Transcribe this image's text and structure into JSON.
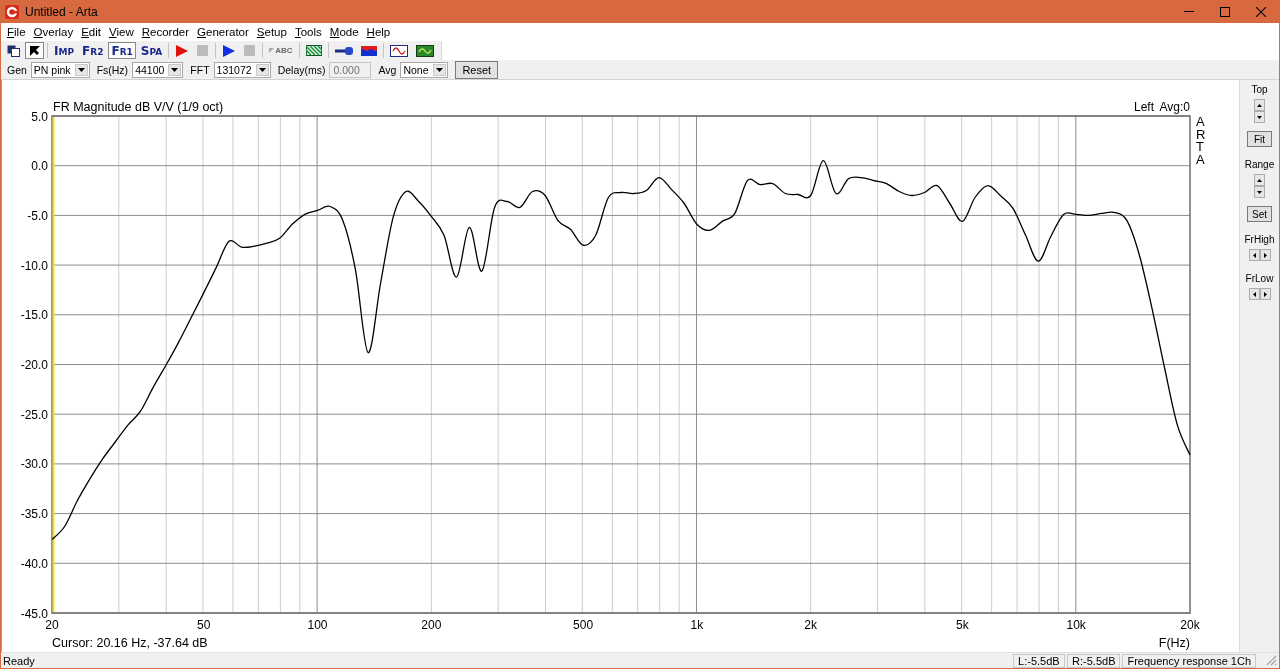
{
  "window": {
    "title": "Untitled - Arta"
  },
  "menu": [
    "File",
    "Overlay",
    "Edit",
    "View",
    "Recorder",
    "Generator",
    "Setup",
    "Tools",
    "Mode",
    "Help"
  ],
  "toolbar": [
    [
      {
        "kind": "pages",
        "selected": false,
        "disabled": false
      },
      {
        "kind": "pointer",
        "selected": true,
        "disabled": false
      }
    ],
    [
      {
        "kind": "text",
        "label": "IMP",
        "selected": false,
        "disabled": false
      },
      {
        "kind": "text",
        "label": "FR2",
        "selected": false,
        "disabled": false
      },
      {
        "kind": "text",
        "label": "FR1",
        "selected": true,
        "disabled": false
      },
      {
        "kind": "text",
        "label": "SPA",
        "selected": false,
        "disabled": false
      }
    ],
    [
      {
        "kind": "play",
        "color": "#e01010",
        "selected": false,
        "disabled": false
      },
      {
        "kind": "stop",
        "selected": false,
        "disabled": true
      }
    ],
    [
      {
        "kind": "play",
        "color": "#1030e0",
        "selected": false,
        "disabled": false
      },
      {
        "kind": "stop",
        "selected": false,
        "disabled": true
      }
    ],
    [
      {
        "kind": "abc",
        "label": "ABC",
        "selected": false,
        "disabled": true
      }
    ],
    [
      {
        "kind": "hatch",
        "selected": false,
        "disabled": false
      }
    ],
    [
      {
        "kind": "probe",
        "selected": false,
        "disabled": false
      },
      {
        "kind": "bars",
        "selected": false,
        "disabled": false
      }
    ],
    [
      {
        "kind": "wave",
        "selected": false,
        "disabled": false
      },
      {
        "kind": "scope",
        "selected": false,
        "disabled": false
      }
    ]
  ],
  "settings": [
    {
      "kind": "combo",
      "label": "Gen",
      "value": "PN pink",
      "disabled": false
    },
    {
      "kind": "combo",
      "label": "Fs(Hz)",
      "value": "44100",
      "disabled": false
    },
    {
      "kind": "combo",
      "label": "FFT",
      "value": "131072",
      "disabled": false
    },
    {
      "kind": "field",
      "label": "Delay(ms)",
      "value": "0.000",
      "disabled": true
    },
    {
      "kind": "combo",
      "label": "Avg",
      "value": "None",
      "disabled": false
    },
    {
      "kind": "button",
      "label": "Reset",
      "disabled": false
    }
  ],
  "plot": {
    "chart_data": {
      "type": "line",
      "title": "FR Magnitude dB V/V (1/9 oct)",
      "xlabel": "F(Hz)",
      "categories": [
        "20",
        null,
        null,
        null,
        null,
        null,
        null,
        null,
        null,
        null,
        null,
        null,
        "50",
        null,
        null,
        null,
        null,
        null,
        null,
        null,
        null,
        "100",
        null,
        null,
        null,
        null,
        null,
        null,
        null,
        null,
        "200",
        null,
        null,
        null,
        null,
        null,
        null,
        null,
        null,
        null,
        null,
        null,
        "500",
        null,
        null,
        null,
        null,
        null,
        null,
        null,
        null,
        "1k",
        null,
        null,
        null,
        null,
        null,
        null,
        null,
        null,
        "2k",
        null,
        null,
        null,
        null,
        null,
        null,
        null,
        null,
        null,
        null,
        null,
        "5k",
        null,
        null,
        null,
        null,
        null,
        null,
        null,
        null,
        "10k",
        null,
        null,
        null,
        null,
        null,
        null,
        null,
        null,
        "20k"
      ],
      "series": [
        {
          "name": "Left",
          "color": "#000000",
          "values": [
            -37.6,
            -36.3,
            -33.7,
            -31.5,
            -29.5,
            -27.8,
            -26.1,
            -24.7,
            -22.3,
            -20.1,
            -17.8,
            -15.3,
            -12.8,
            -10.2,
            -7.6,
            -8.2,
            -8.1,
            -7.8,
            -7.3,
            -5.9,
            -4.9,
            -4.5,
            -4.1,
            -5.5,
            -10.5,
            -18.8,
            -11.7,
            -5.1,
            -2.6,
            -3.6,
            -5.1,
            -7.0,
            -11.2,
            -6.2,
            -10.6,
            -4.2,
            -3.6,
            -4.2,
            -2.6,
            -3.0,
            -5.5,
            -6.4,
            -8.0,
            -7.0,
            -3.2,
            -2.7,
            -2.8,
            -2.5,
            -1.2,
            -2.4,
            -3.8,
            -5.9,
            -6.5,
            -5.6,
            -4.8,
            -1.5,
            -1.9,
            -1.8,
            -2.8,
            -2.9,
            -3.0,
            0.5,
            -2.8,
            -1.3,
            -1.2,
            -1.5,
            -1.8,
            -2.6,
            -3.0,
            -2.7,
            -2.0,
            -3.8,
            -5.6,
            -3.2,
            -2.0,
            -3.0,
            -4.3,
            -7.0,
            -9.6,
            -7.1,
            -4.9,
            -4.9,
            -5.0,
            -4.8,
            -4.7,
            -5.5,
            -9.0,
            -14.4,
            -20.4,
            -26.1,
            -29.1
          ]
        }
      ],
      "ylim": [
        -45,
        5
      ],
      "yticks": [
        {
          "value": 5,
          "label": "5.0"
        },
        {
          "value": 0,
          "label": "0.0"
        },
        {
          "value": -5,
          "label": "-5.0"
        },
        {
          "value": -10,
          "label": "-10.0"
        },
        {
          "value": -15,
          "label": "-15.0"
        },
        {
          "value": -20,
          "label": "-20.0"
        },
        {
          "value": -25,
          "label": "-25.0"
        },
        {
          "value": -30,
          "label": "-30.0"
        },
        {
          "value": -35,
          "label": "-35.0"
        },
        {
          "value": -40,
          "label": "-40.0"
        },
        {
          "value": -45,
          "label": "-45.0"
        }
      ],
      "grid": true,
      "annotations": [
        "Cursor: 20.16 Hz, -37.64 dB"
      ]
    },
    "average": "Avg:0",
    "brand": "ARTA"
  },
  "side_panel": [
    {
      "kind": "label",
      "text": "Top"
    },
    {
      "kind": "spin-vertical"
    },
    {
      "kind": "button",
      "text": "Fit"
    },
    {
      "kind": "label",
      "text": "Range"
    },
    {
      "kind": "spin-vertical"
    },
    {
      "kind": "button",
      "text": "Set"
    },
    {
      "kind": "label",
      "text": "FrHigh"
    },
    {
      "kind": "spin-horizontal"
    },
    {
      "kind": "label",
      "text": "FrLow"
    },
    {
      "kind": "spin-horizontal"
    }
  ],
  "status_bar": {
    "text": "Ready",
    "panels": [
      "L:-5.5dB",
      "R:-5.5dB",
      "Frequency response 1Ch"
    ]
  }
}
